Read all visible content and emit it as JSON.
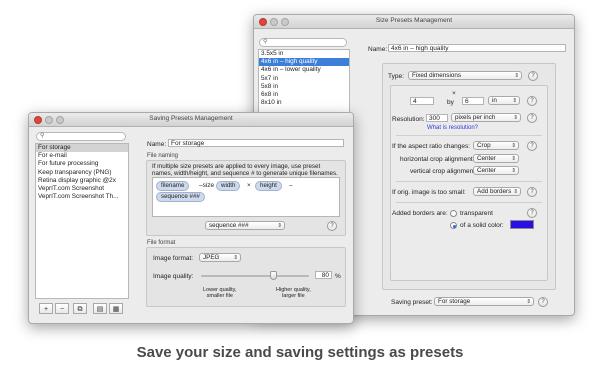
{
  "back_window": {
    "title": "Size Presets Management",
    "presets": [
      "3.5x5 in",
      "4x6 in – high quality",
      "4x6 in – lower quality",
      "5x7 in",
      "5x8 in",
      "6x8 in",
      "8x10 in"
    ],
    "selected_index": 1,
    "name_label": "Name:",
    "name_value": "4x6 in – high quality",
    "type_label": "Type:",
    "type_value": "Fixed dimensions",
    "times_sign": "×",
    "width_value": "4",
    "by_label": "by",
    "height_value": "6",
    "unit_value": "in",
    "resolution_label": "Resolution:",
    "resolution_value": "300",
    "resolution_unit": "pixels per inch",
    "resolution_link": "What is resolution?",
    "aspect_label": "If the aspect ratio changes:",
    "aspect_value": "Crop",
    "hcrop_label": "horizontal crop alignment:",
    "hcrop_value": "Center",
    "vcrop_label": "vertical crop alignment:",
    "vcrop_value": "Center",
    "small_label": "If orig. image is too small:",
    "small_value": "Add borders",
    "borders_label": "Added borders are:",
    "transparent_label": "transparent",
    "solid_label": "of a solid color:",
    "border_color": "#2a0ee6",
    "saving_label": "Saving preset:",
    "saving_value": "For storage",
    "help_glyph": "?"
  },
  "front_window": {
    "title": "Saving Presets Management",
    "presets": [
      "For storage",
      "For e-mail",
      "For future processing",
      "Keep transparency (PNG)",
      "Retina display graphic @2x",
      "VeprIT.com Screenshot",
      "VeprIT.com Screenshot Th..."
    ],
    "selected_index": 0,
    "name_label": "Name:",
    "name_value": "For storage",
    "file_naming_label": "File naming",
    "naming_help": "If multiple size presets are applied to every image, use preset names, width/height, and sequence # to generate unique filenames.",
    "tokens": {
      "filename": "filename",
      "size_text": "–size",
      "width": "width",
      "x_text": "×",
      "height": "height",
      "dash_text": "–",
      "sequence": "sequence ###"
    },
    "insert_select_value": "sequence ###",
    "file_format_label": "File format",
    "image_format_label": "Image format:",
    "image_format_value": "JPEG",
    "quality_label": "Image quality:",
    "quality_value": "80",
    "quality_unit": "%",
    "quality_level": 0.8,
    "lower_quality_line1": "Lower quality,",
    "lower_quality_line2": "smaller file",
    "higher_quality_line1": "Higher quality,",
    "higher_quality_line2": "larger file",
    "buttons": {
      "add": "+",
      "remove": "−"
    },
    "help_glyph": "?"
  },
  "caption": "Save your size and saving settings as presets"
}
